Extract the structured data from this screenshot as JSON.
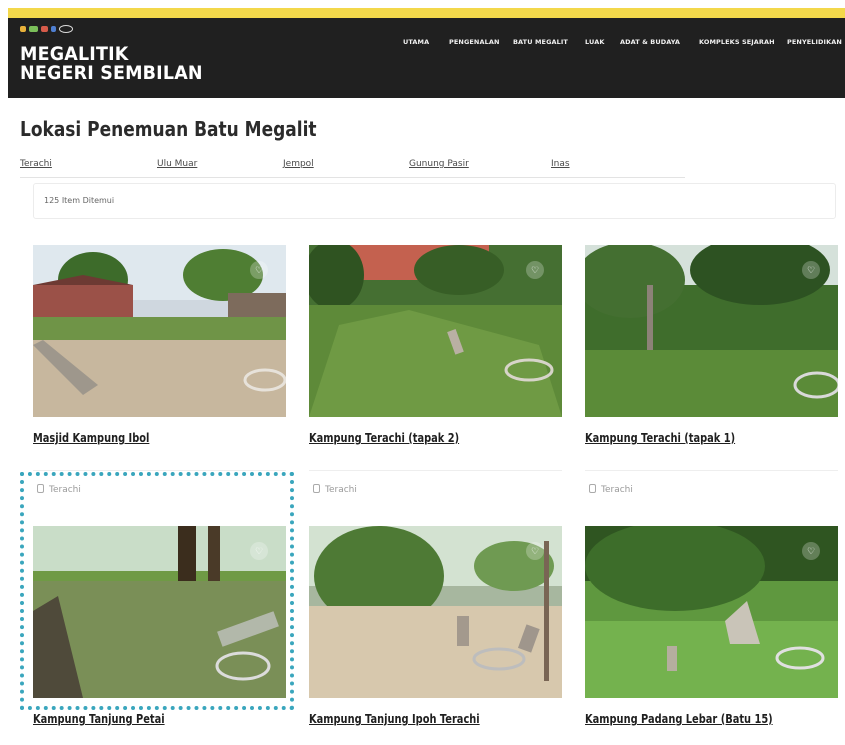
{
  "colors": {
    "top_strip": "#f3d84b",
    "header_bg": "#202020",
    "highlight": "#3aa6bd"
  },
  "header": {
    "site_title": "MEGALITIK NEGERI SEMBILAN",
    "nav": [
      "UTAMA",
      "PENGENALAN",
      "BATU MEGALIT",
      "LUAK",
      "ADAT & BUDAYA",
      "KOMPLEKS SEJARAH",
      "PENYELIDIKAN"
    ]
  },
  "main": {
    "heading": "Lokasi Penemuan Batu Megalit",
    "filters": [
      "Terachi",
      "Ulu Muar",
      "Jempol",
      "Gunung Pasir",
      "Inas"
    ],
    "result_count": "125 Item Ditemui"
  },
  "cards": [
    {
      "title": "Masjid Kampung Ibol",
      "location": "Terachi",
      "icon": "heart-icon"
    },
    {
      "title": "Kampung Terachi (tapak 2)",
      "location": "Terachi",
      "icon": "heart-icon"
    },
    {
      "title": "Kampung Terachi (tapak 1)",
      "location": "Terachi",
      "icon": "heart-icon"
    },
    {
      "title": "Kampung Tanjung Petai",
      "location": "",
      "icon": "heart-icon"
    },
    {
      "title": "Kampung Tanjung Ipoh Terachi",
      "location": "",
      "icon": "heart-icon"
    },
    {
      "title": "Kampung Padang Lebar (Batu 15)",
      "location": "",
      "icon": "heart-icon"
    }
  ]
}
